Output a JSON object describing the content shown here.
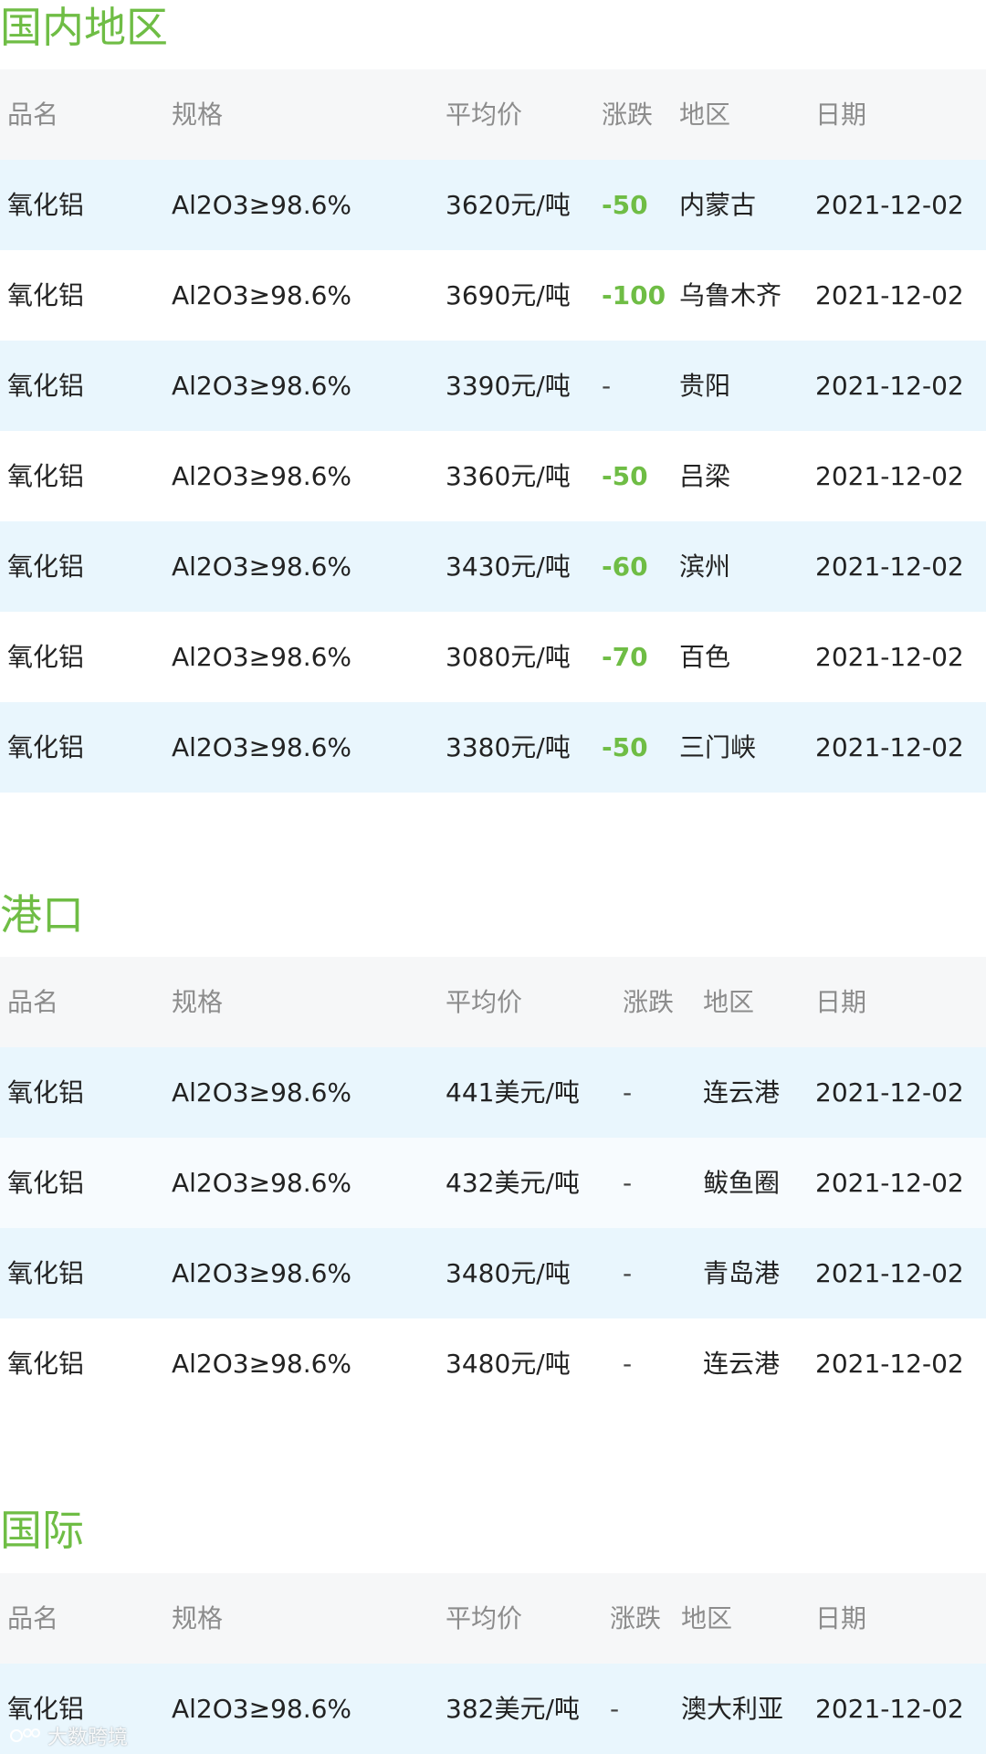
{
  "sections": [
    {
      "title": "国内地区",
      "headers": {
        "name": "品名",
        "spec": "规格",
        "price": "平均价",
        "change": "涨跌",
        "region": "地区",
        "date": "日期"
      },
      "rows": [
        {
          "name": "氧化铝",
          "spec": "Al2O3≥98.6%",
          "price": "3620元/吨",
          "change": "-50",
          "region": "内蒙古",
          "date": "2021-12-02"
        },
        {
          "name": "氧化铝",
          "spec": "Al2O3≥98.6%",
          "price": "3690元/吨",
          "change": "-100",
          "region": "乌鲁木齐",
          "date": "2021-12-02"
        },
        {
          "name": "氧化铝",
          "spec": "Al2O3≥98.6%",
          "price": "3390元/吨",
          "change": "-",
          "region": "贵阳",
          "date": "2021-12-02"
        },
        {
          "name": "氧化铝",
          "spec": "Al2O3≥98.6%",
          "price": "3360元/吨",
          "change": "-50",
          "region": "吕梁",
          "date": "2021-12-02"
        },
        {
          "name": "氧化铝",
          "spec": "Al2O3≥98.6%",
          "price": "3430元/吨",
          "change": "-60",
          "region": "滨州",
          "date": "2021-12-02"
        },
        {
          "name": "氧化铝",
          "spec": "Al2O3≥98.6%",
          "price": "3080元/吨",
          "change": "-70",
          "region": "百色",
          "date": "2021-12-02"
        },
        {
          "name": "氧化铝",
          "spec": "Al2O3≥98.6%",
          "price": "3380元/吨",
          "change": "-50",
          "region": "三门峡",
          "date": "2021-12-02"
        }
      ]
    },
    {
      "title": "港口",
      "headers": {
        "name": "品名",
        "spec": "规格",
        "price": "平均价",
        "change": "涨跌",
        "region": "地区",
        "date": "日期"
      },
      "rows": [
        {
          "name": "氧化铝",
          "spec": "Al2O3≥98.6%",
          "price": "441美元/吨",
          "change": "-",
          "region": "连云港",
          "date": "2021-12-02"
        },
        {
          "name": "氧化铝",
          "spec": "Al2O3≥98.6%",
          "price": "432美元/吨",
          "change": "-",
          "region": "鲅鱼圈",
          "date": "2021-12-02"
        },
        {
          "name": "氧化铝",
          "spec": "Al2O3≥98.6%",
          "price": "3480元/吨",
          "change": "-",
          "region": "青岛港",
          "date": "2021-12-02"
        },
        {
          "name": "氧化铝",
          "spec": "Al2O3≥98.6%",
          "price": "3480元/吨",
          "change": "-",
          "region": "连云港",
          "date": "2021-12-02"
        }
      ]
    },
    {
      "title": "国际",
      "headers": {
        "name": "品名",
        "spec": "规格",
        "price": "平均价",
        "change": "涨跌",
        "region": "地区",
        "date": "日期"
      },
      "rows": [
        {
          "name": "氧化铝",
          "spec": "Al2O3≥98.6%",
          "price": "382美元/吨",
          "change": "-",
          "region": "澳大利亚",
          "date": "2021-12-02"
        }
      ]
    }
  ],
  "watermark": {
    "text": "大数跨境"
  },
  "colors": {
    "accent_green": "#6fbd45",
    "row_tint": "#e9f6fd",
    "header_bg": "#f6f7f8",
    "header_text": "#8c8c8c"
  }
}
